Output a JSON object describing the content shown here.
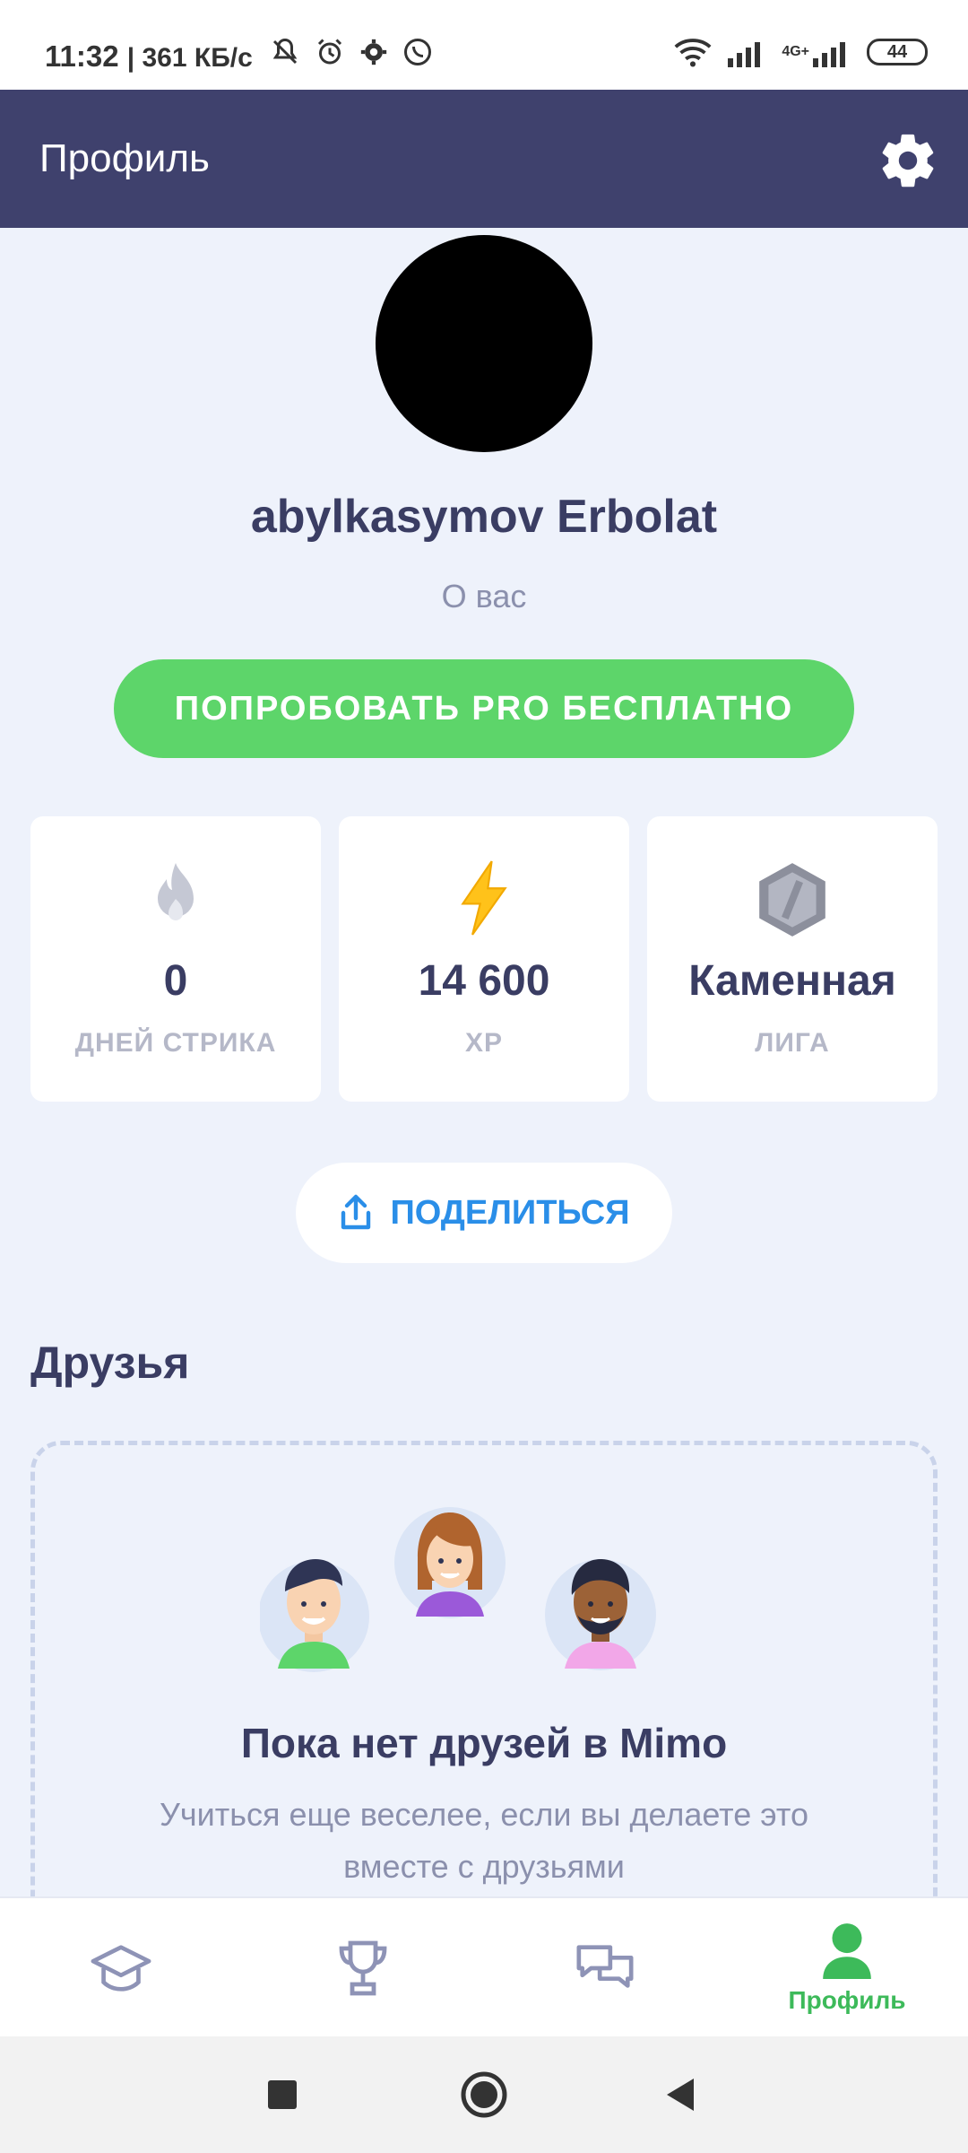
{
  "status_bar": {
    "time": "11:32",
    "speed": "| 361 КБ/с",
    "battery": "44",
    "network": "4G+"
  },
  "app_bar": {
    "title": "Профиль",
    "settings_icon": "gear-icon"
  },
  "profile": {
    "name": "abylkasymov Erbolat",
    "about": "О вас"
  },
  "pro_button": {
    "label": "ПОПРОБОВАТЬ PRO БЕСПЛАТНО"
  },
  "stats": [
    {
      "icon": "flame-icon",
      "value": "0",
      "label": "ДНЕЙ СТРИКА"
    },
    {
      "icon": "lightning-icon",
      "value": "14 600",
      "label": "XP"
    },
    {
      "icon": "league-badge-icon",
      "value": "Каменная",
      "label": "ЛИГА"
    }
  ],
  "share_button": {
    "label": "ПОДЕЛИТЬСЯ",
    "icon": "share-icon"
  },
  "friends": {
    "title": "Друзья",
    "empty_title": "Пока нет друзей в Mimo",
    "empty_text": "Учиться еще веселее, если вы делаете это вместе с друзьями"
  },
  "bottom_nav": {
    "items": [
      {
        "icon": "graduation-cap-icon",
        "label": ""
      },
      {
        "icon": "trophy-icon",
        "label": ""
      },
      {
        "icon": "chat-icon",
        "label": ""
      },
      {
        "icon": "profile-icon",
        "label": "Профиль",
        "active": true
      }
    ]
  },
  "colors": {
    "header": "#3f416d",
    "accent_green": "#5dd56a",
    "share_blue": "#2a8ee8",
    "background": "#eef2fb",
    "text_dark": "#3a3d63"
  }
}
